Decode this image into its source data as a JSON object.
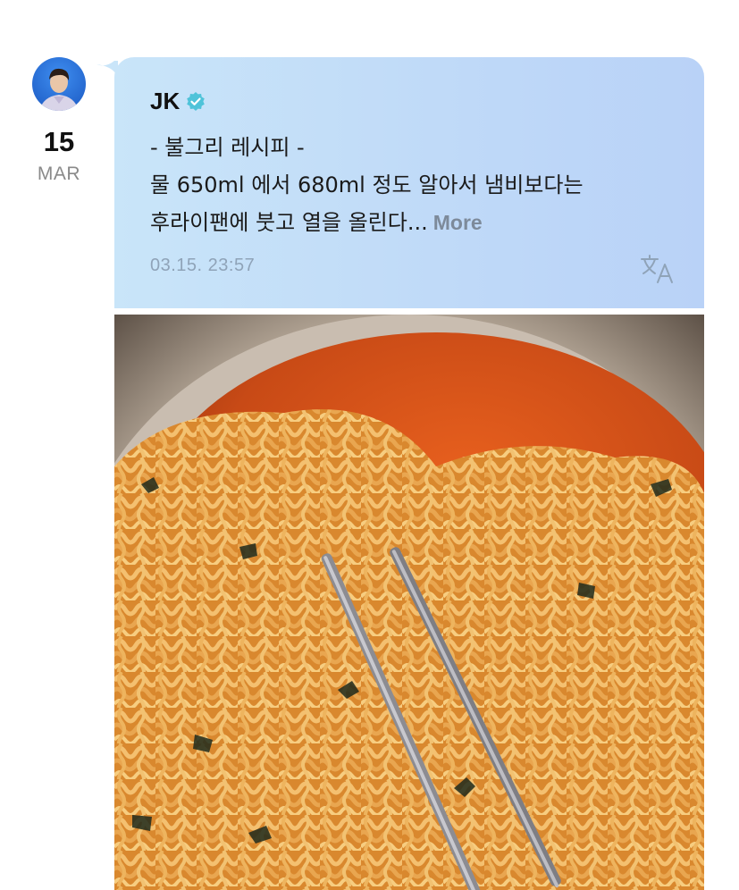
{
  "post": {
    "author": {
      "name": "JK",
      "verified": true,
      "avatar_icon": "profile-avatar"
    },
    "date": {
      "day": "15",
      "month": "MAR"
    },
    "body_lines": [
      "- 불그리 레시피 -",
      "물 650ml 에서 680ml 정도 알아서 냄비보다는",
      "후라이팬에 붓고 열을 올린다..."
    ],
    "more_label": "More",
    "timestamp": "03.15. 23:57",
    "translate_icon": "translate-icon",
    "photo": {
      "subject_icon": "noodles-photo"
    }
  },
  "colors": {
    "bubble_start": "#c9e5f9",
    "bubble_end": "#b9d2f7",
    "verified_badge": "#4fc3d9",
    "more_link": "#7d8a9a",
    "timestamp": "#8fa3b8"
  }
}
